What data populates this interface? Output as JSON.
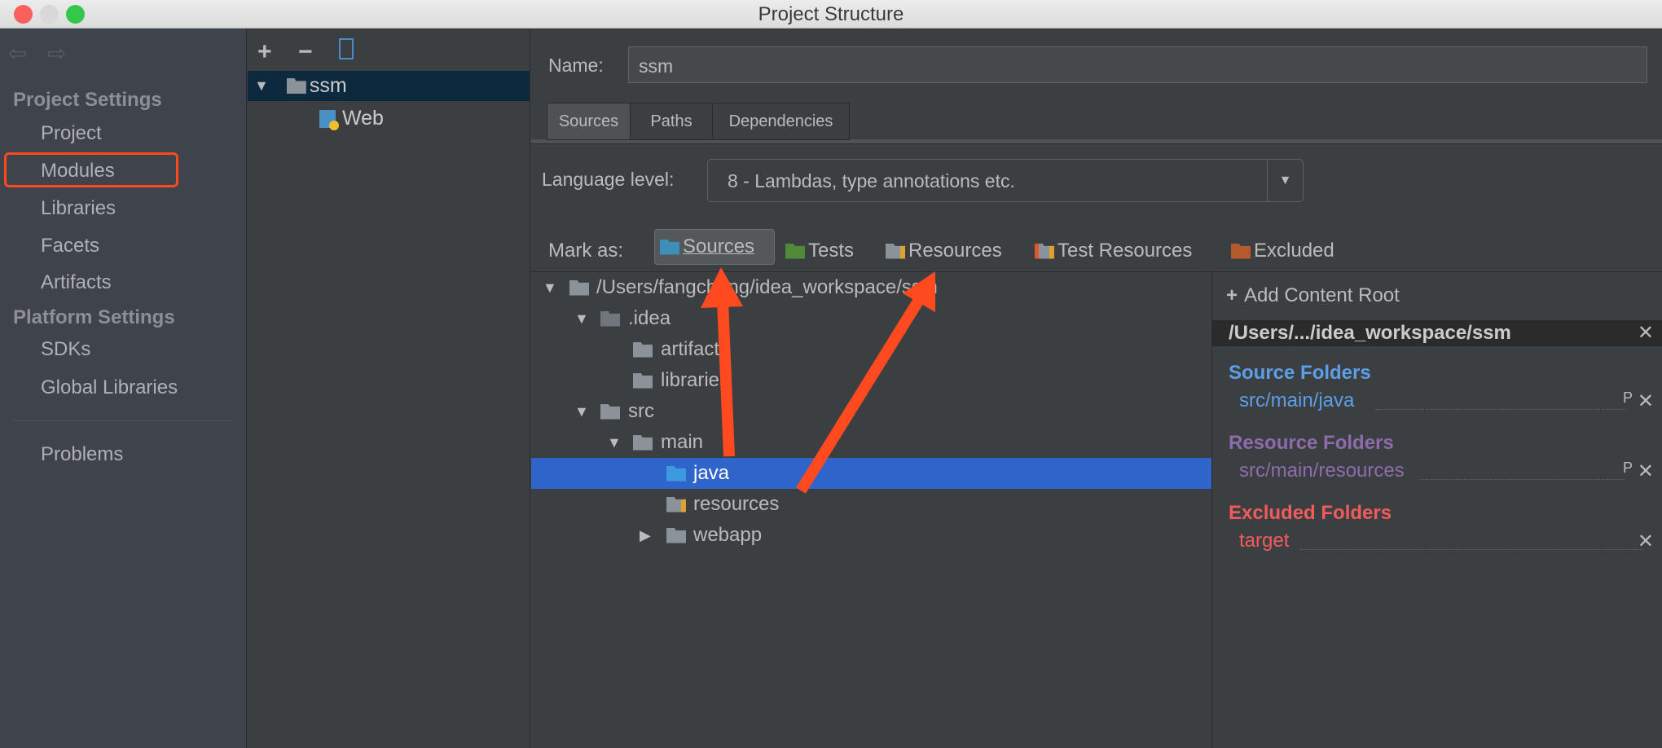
{
  "window": {
    "title": "Project Structure"
  },
  "sidebar": {
    "project_settings": "Project Settings",
    "items1": [
      "Project",
      "Modules",
      "Libraries",
      "Facets",
      "Artifacts"
    ],
    "platform_settings": "Platform Settings",
    "items2": [
      "SDKs",
      "Global Libraries"
    ],
    "problems": "Problems",
    "selected": "Modules",
    "highlight_color": "#ff4a1f"
  },
  "modules": {
    "toolbar": {
      "add": "+",
      "remove": "−"
    },
    "tree": [
      {
        "label": "ssm"
      },
      {
        "label": "Web"
      }
    ]
  },
  "main": {
    "name_label": "Name:",
    "name_value": "ssm",
    "tabs": [
      "Sources",
      "Paths",
      "Dependencies"
    ],
    "active_tab": "Sources",
    "language_label": "Language level:",
    "language_value": "8 - Lambdas, type annotations etc.",
    "mark_as": "Mark as:",
    "mark_buttons": [
      "Sources",
      "Tests",
      "Resources",
      "Test Resources",
      "Excluded"
    ],
    "tree": [
      "/Users/fangcheng/idea_workspace/ssm",
      ".idea",
      "artifacts",
      "libraries",
      "src",
      "main",
      "java",
      "resources",
      "webapp"
    ],
    "selected_tree_item": "java"
  },
  "roots": {
    "add": "Add Content Root",
    "path": "/Users/.../idea_workspace/ssm",
    "source_title": "Source Folders",
    "source_item": "src/main/java",
    "resource_title": "Resource Folders",
    "resource_item": "src/main/resources",
    "excluded_title": "Excluded Folders",
    "excluded_item": "target",
    "props": "P"
  },
  "colors": {
    "source": "#5c9fe8",
    "resource": "#8d6bac",
    "excluded": "#f25b5b",
    "selection": "#2f65ca",
    "annotation": "#ff4a1f"
  }
}
